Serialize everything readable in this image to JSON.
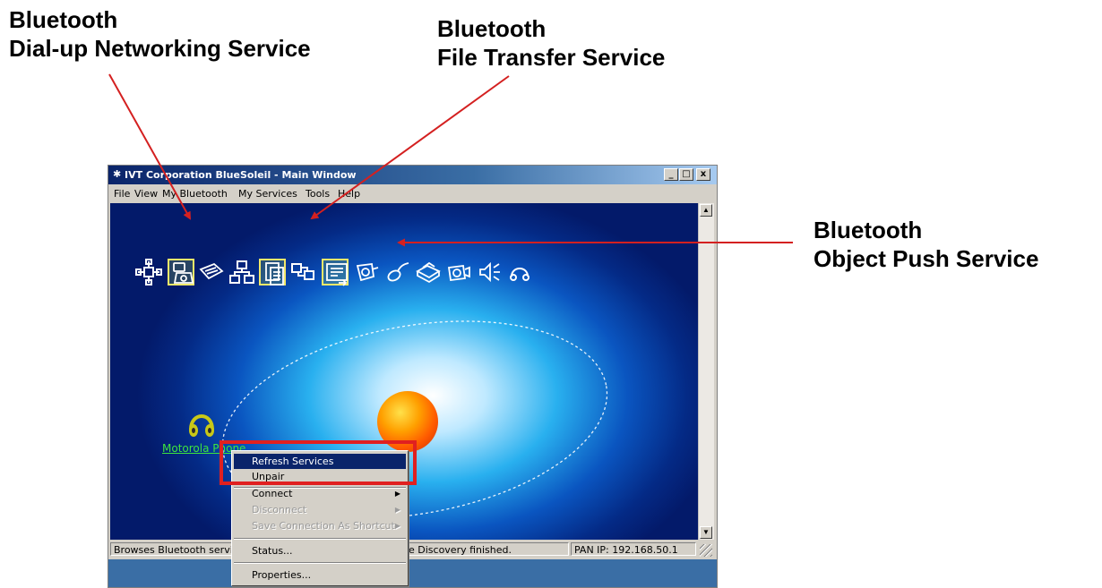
{
  "callouts": {
    "dialup": {
      "line1": "Bluetooth",
      "line2": "Dial-up Networking Service"
    },
    "file_transfer": {
      "line1": "Bluetooth",
      "line2": "File Transfer Service"
    },
    "object_push": {
      "line1": "Bluetooth",
      "line2": "Object Push Service"
    }
  },
  "window": {
    "title": "IVT Corporation BlueSoleil - Main Window",
    "buttons": {
      "minimize": "_",
      "restore": "□",
      "close": "x"
    }
  },
  "menubar": [
    "File",
    "View",
    "My Bluetooth",
    "My Services",
    "Tools",
    "Help"
  ],
  "services": [
    {
      "icon": "personal-area-network-icon",
      "highlighted": false
    },
    {
      "icon": "dial-up-networking-icon",
      "highlighted": true
    },
    {
      "icon": "fax-icon",
      "highlighted": false
    },
    {
      "icon": "lan-access-icon",
      "highlighted": false
    },
    {
      "icon": "file-transfer-icon",
      "highlighted": true
    },
    {
      "icon": "synchronization-icon",
      "highlighted": false
    },
    {
      "icon": "object-push-icon",
      "highlighted": true
    },
    {
      "icon": "serial-port-icon",
      "highlighted": false
    },
    {
      "icon": "hid-icon",
      "highlighted": false
    },
    {
      "icon": "printer-icon",
      "highlighted": false
    },
    {
      "icon": "basic-imaging-icon",
      "highlighted": false
    },
    {
      "icon": "audio-gateway-icon",
      "highlighted": false
    },
    {
      "icon": "headset-icon",
      "highlighted": false
    }
  ],
  "device": {
    "name": "Motorola Phone",
    "icon": "headset-icon"
  },
  "context_menu": {
    "items": [
      {
        "label": "Refresh Services",
        "state": "selected",
        "submenu": false
      },
      {
        "label": "Unpair",
        "state": "normal",
        "submenu": false
      },
      {
        "label": "Connect",
        "state": "normal",
        "submenu": true
      },
      {
        "label": "Disconnect",
        "state": "disabled",
        "submenu": true
      },
      {
        "label": "Save Connection As Shortcut",
        "state": "disabled",
        "submenu": true
      },
      {
        "label": "Status...",
        "state": "normal",
        "submenu": false
      },
      {
        "label": "Properties...",
        "state": "normal",
        "submenu": false
      }
    ]
  },
  "statusbar": {
    "left": "Browses Bluetooth servic",
    "middle": "e Discovery finished.",
    "right": "PAN IP: 192.168.50.1"
  },
  "colors": {
    "highlight_box": "#e02020",
    "arrow": "#d42020",
    "device_label": "#3ee53e",
    "menu_selected": "#0a246a"
  }
}
